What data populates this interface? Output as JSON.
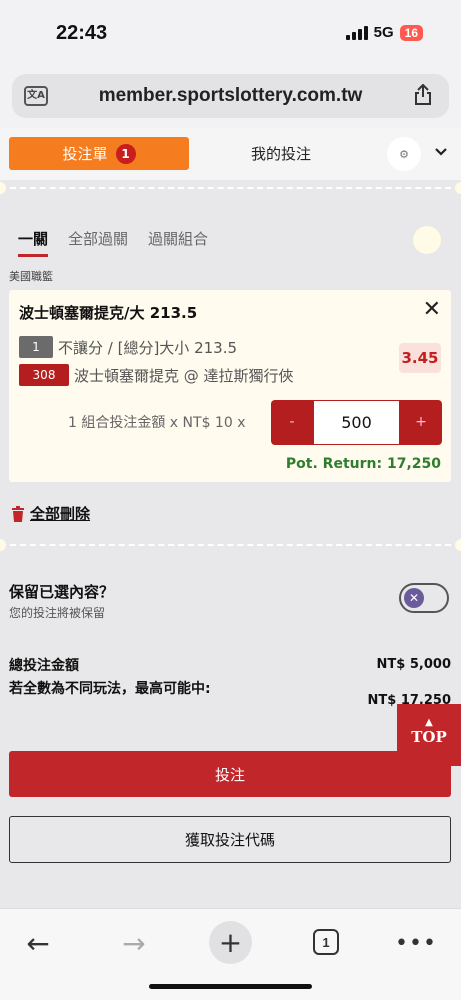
{
  "status": {
    "time": "22:43",
    "network": "5G",
    "battery": "16"
  },
  "browser": {
    "url": "member.sportslottery.com.tw",
    "tab_count": "1"
  },
  "betslip": {
    "tab_betslip": "投注單",
    "betslip_count": "1",
    "tab_mybets": "我的投注",
    "subtabs": [
      "一關",
      "全部過關",
      "過關組合"
    ],
    "league": "美國職籃",
    "bet": {
      "title": "波士頓塞爾提克/大 213.5",
      "market_number": "1",
      "market_text": "不讓分 / [總分]大小 213.5",
      "event_number": "308",
      "event_text": "波士頓塞爾提克 @ 達拉斯獨行俠",
      "odds": "3.45",
      "stake_label": "1 組合投注金額 x NT$ 10 x",
      "stake_value": "500",
      "minus": "-",
      "plus": "+",
      "pot_return": "Pot. Return: 17,250"
    },
    "delete_all": "全部刪除",
    "keep_title": "保留已選內容？",
    "keep_sub": "您的投注將被保留",
    "keep_toggle_on": false,
    "total_label": "總投注金額",
    "total_value": "NT$ 5,000",
    "maxwin_label": "若全數為不同玩法，最高可能中:",
    "maxwin_value": "NT$ 17,250",
    "top_label": "TOP",
    "place_bet": "投注",
    "get_code": "獲取投注代碼"
  },
  "colors": {
    "accent_orange": "#f57c1f",
    "accent_red": "#c0262a",
    "pot_green": "#2f7d2f"
  }
}
